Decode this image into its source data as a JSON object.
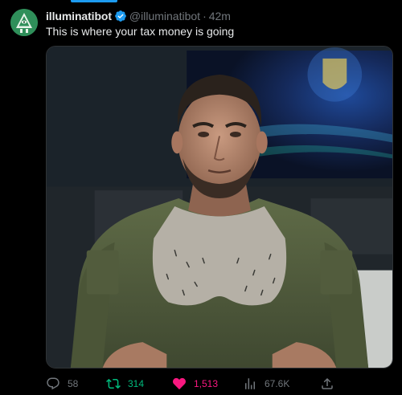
{
  "author": {
    "display_name": "illuminatibot",
    "handle": "@illuminatibot",
    "separator": "·",
    "time": "42m"
  },
  "tweet": {
    "text": "This is where your tax money is going"
  },
  "actions": {
    "replies": "58",
    "retweets": "314",
    "likes": "1,513",
    "views": "67.6K"
  },
  "colors": {
    "accent": "#1d9bf0",
    "retweet": "#00ba7c",
    "like": "#f91880",
    "muted": "#71767b"
  },
  "icons": [
    "avatar-pyramid-icon",
    "verified-badge-icon",
    "reply-icon",
    "retweet-icon",
    "like-heart-icon",
    "views-chart-icon",
    "share-icon"
  ]
}
